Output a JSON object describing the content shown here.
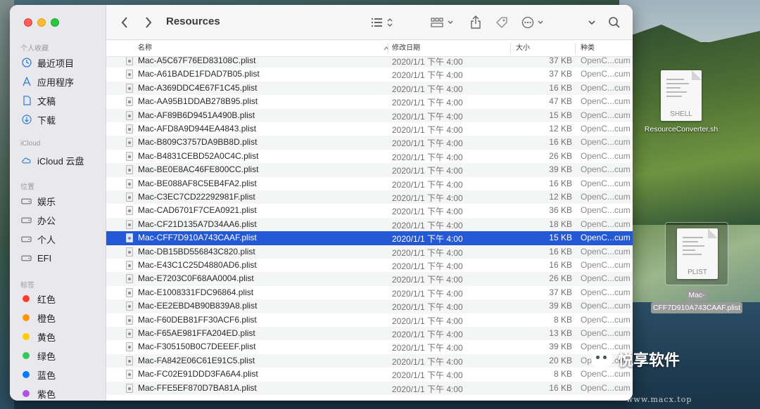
{
  "window": {
    "title": "Resources"
  },
  "sidebar": {
    "favorites_header": "个人收藏",
    "favorites": [
      {
        "label": "最近项目",
        "icon": "clock-icon"
      },
      {
        "label": "应用程序",
        "icon": "apps-icon"
      },
      {
        "label": "文稿",
        "icon": "document-icon"
      },
      {
        "label": "下载",
        "icon": "download-icon"
      }
    ],
    "icloud_header": "iCloud",
    "icloud": [
      {
        "label": "iCloud 云盘",
        "icon": "cloud-icon"
      }
    ],
    "locations_header": "位置",
    "locations": [
      {
        "label": "娱乐",
        "icon": "disk-icon"
      },
      {
        "label": "办公",
        "icon": "disk-icon"
      },
      {
        "label": "个人",
        "icon": "disk-icon"
      },
      {
        "label": "EFI",
        "icon": "disk-icon"
      }
    ],
    "tags_header": "标签",
    "tags": [
      {
        "label": "红色",
        "color": "#ff3b30"
      },
      {
        "label": "橙色",
        "color": "#ff9500"
      },
      {
        "label": "黄色",
        "color": "#ffcc00"
      },
      {
        "label": "绿色",
        "color": "#34c759"
      },
      {
        "label": "蓝色",
        "color": "#007aff"
      },
      {
        "label": "紫色",
        "color": "#af52de"
      }
    ]
  },
  "columns": {
    "name": "名称",
    "date": "修改日期",
    "size": "大小",
    "kind": "种类"
  },
  "files": [
    {
      "name": "Mac-A5C67F76ED83108C.plist",
      "date": "2020/1/1 下午 4:00",
      "size": "37 KB",
      "kind": "OpenC...cum"
    },
    {
      "name": "Mac-A61BADE1FDAD7B05.plist",
      "date": "2020/1/1 下午 4:00",
      "size": "37 KB",
      "kind": "OpenC...cum"
    },
    {
      "name": "Mac-A369DDC4E67F1C45.plist",
      "date": "2020/1/1 下午 4:00",
      "size": "16 KB",
      "kind": "OpenC...cum"
    },
    {
      "name": "Mac-AA95B1DDAB278B95.plist",
      "date": "2020/1/1 下午 4:00",
      "size": "47 KB",
      "kind": "OpenC...cum"
    },
    {
      "name": "Mac-AF89B6D9451A490B.plist",
      "date": "2020/1/1 下午 4:00",
      "size": "15 KB",
      "kind": "OpenC...cum"
    },
    {
      "name": "Mac-AFD8A9D944EA4843.plist",
      "date": "2020/1/1 下午 4:00",
      "size": "12 KB",
      "kind": "OpenC...cum"
    },
    {
      "name": "Mac-B809C3757DA9BB8D.plist",
      "date": "2020/1/1 下午 4:00",
      "size": "16 KB",
      "kind": "OpenC...cum"
    },
    {
      "name": "Mac-B4831CEBD52A0C4C.plist",
      "date": "2020/1/1 下午 4:00",
      "size": "26 KB",
      "kind": "OpenC...cum"
    },
    {
      "name": "Mac-BE0E8AC46FE800CC.plist",
      "date": "2020/1/1 下午 4:00",
      "size": "39 KB",
      "kind": "OpenC...cum"
    },
    {
      "name": "Mac-BE088AF8C5EB4FA2.plist",
      "date": "2020/1/1 下午 4:00",
      "size": "16 KB",
      "kind": "OpenC...cum"
    },
    {
      "name": "Mac-C3EC7CD22292981F.plist",
      "date": "2020/1/1 下午 4:00",
      "size": "12 KB",
      "kind": "OpenC...cum"
    },
    {
      "name": "Mac-CAD6701F7CEA0921.plist",
      "date": "2020/1/1 下午 4:00",
      "size": "36 KB",
      "kind": "OpenC...cum"
    },
    {
      "name": "Mac-CF21D135A7D34AA6.plist",
      "date": "2020/1/1 下午 4:00",
      "size": "18 KB",
      "kind": "OpenC...cum"
    },
    {
      "name": "Mac-CFF7D910A743CAAF.plist",
      "date": "2020/1/1 下午 4:00",
      "size": "15 KB",
      "kind": "OpenC...cum",
      "selected": true
    },
    {
      "name": "Mac-DB15BD556843C820.plist",
      "date": "2020/1/1 下午 4:00",
      "size": "16 KB",
      "kind": "OpenC...cum"
    },
    {
      "name": "Mac-E43C1C25D4880AD6.plist",
      "date": "2020/1/1 下午 4:00",
      "size": "16 KB",
      "kind": "OpenC...cum"
    },
    {
      "name": "Mac-E7203C0F68AA0004.plist",
      "date": "2020/1/1 下午 4:00",
      "size": "26 KB",
      "kind": "OpenC...cum"
    },
    {
      "name": "Mac-E1008331FDC96864.plist",
      "date": "2020/1/1 下午 4:00",
      "size": "37 KB",
      "kind": "OpenC...cum"
    },
    {
      "name": "Mac-EE2EBD4B90B839A8.plist",
      "date": "2020/1/1 下午 4:00",
      "size": "39 KB",
      "kind": "OpenC...cum"
    },
    {
      "name": "Mac-F60DEB81FF30ACF6.plist",
      "date": "2020/1/1 下午 4:00",
      "size": "8 KB",
      "kind": "OpenC...cum"
    },
    {
      "name": "Mac-F65AE981FFA204ED.plist",
      "date": "2020/1/1 下午 4:00",
      "size": "13 KB",
      "kind": "OpenC...cum"
    },
    {
      "name": "Mac-F305150B0C7DEEEF.plist",
      "date": "2020/1/1 下午 4:00",
      "size": "39 KB",
      "kind": "OpenC...cum"
    },
    {
      "name": "Mac-FA842E06C61E91C5.plist",
      "date": "2020/1/1 下午 4:00",
      "size": "20 KB",
      "kind": "OpenC...cum"
    },
    {
      "name": "Mac-FC02E91DDD3FA6A4.plist",
      "date": "2020/1/1 下午 4:00",
      "size": "8 KB",
      "kind": "OpenC...cum"
    },
    {
      "name": "Mac-FFE5EF870D7BA81A.plist",
      "date": "2020/1/1 下午 4:00",
      "size": "16 KB",
      "kind": "OpenC...cum"
    }
  ],
  "desktop": {
    "shell_file": {
      "label": "ResourceConverter.sh",
      "ext": "SHELL"
    },
    "plist_file": {
      "label_line1": "Mac-",
      "label_line2": "CFF7D910A743CAAF.plist",
      "ext": "PLIST"
    }
  },
  "watermark": {
    "text": "悦享软件",
    "url": "www.macx.top"
  }
}
